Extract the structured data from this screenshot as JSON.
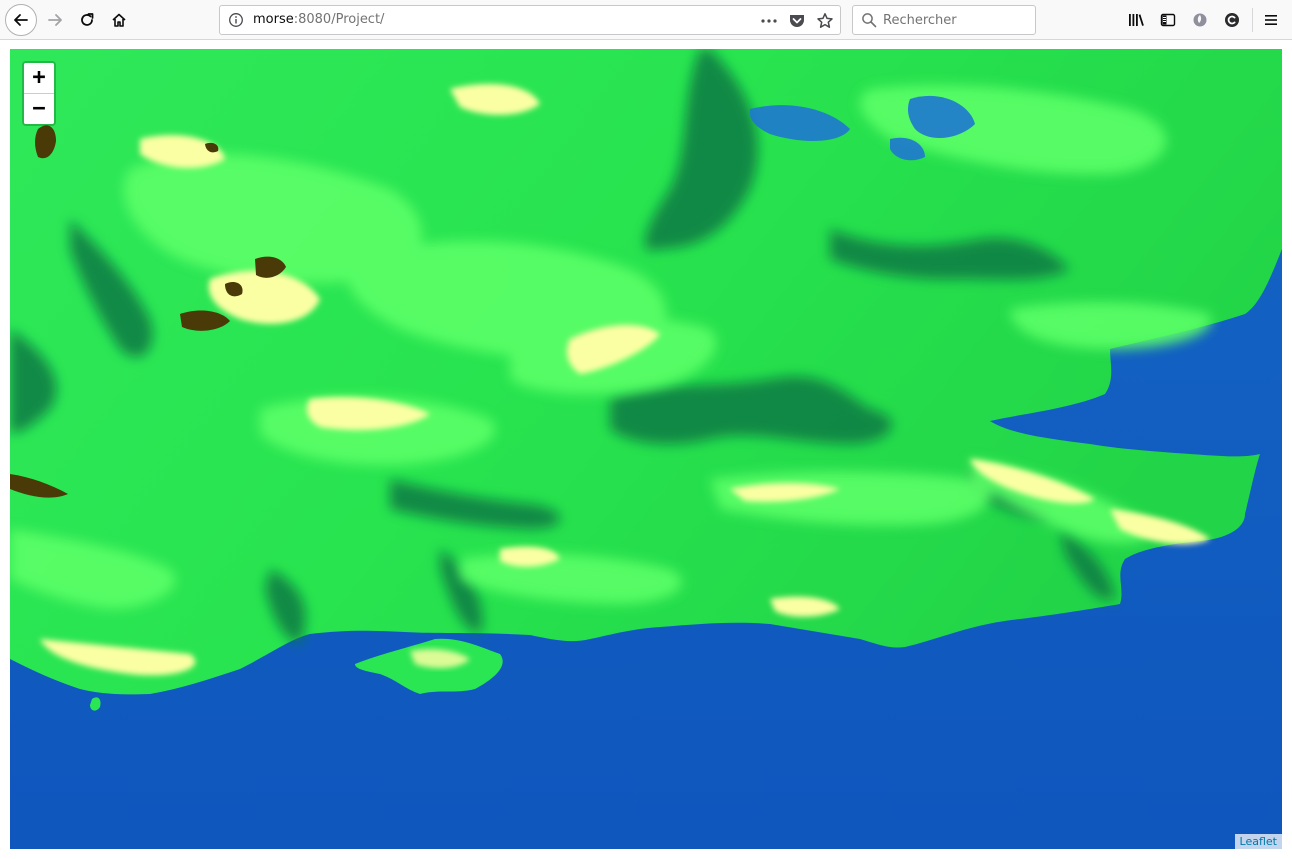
{
  "browser": {
    "url_host": "morse",
    "url_rest": ":8080/Project/",
    "search_placeholder": "Rechercher"
  },
  "map": {
    "zoom_in_label": "+",
    "zoom_out_label": "−",
    "attribution": "Leaflet",
    "colors": {
      "sea": "#135bbf",
      "lowland": "#0e7a45",
      "midland": "#18d64a",
      "upland": "#5cff68",
      "highland": "#fbffa3",
      "peak": "#4a3a08"
    }
  },
  "icons": {
    "back": "back-arrow-icon",
    "forward": "forward-arrow-icon",
    "reload": "reload-icon",
    "home": "home-icon",
    "page_info": "info-icon",
    "page_actions": "ellipsis-icon",
    "pocket": "pocket-icon",
    "bookmark": "star-icon",
    "search": "search-icon",
    "library": "library-icon",
    "sidebar": "sidebar-icon",
    "extension_1": "circle-extension-icon",
    "extension_2": "c-extension-icon",
    "menu": "hamburger-menu-icon"
  }
}
